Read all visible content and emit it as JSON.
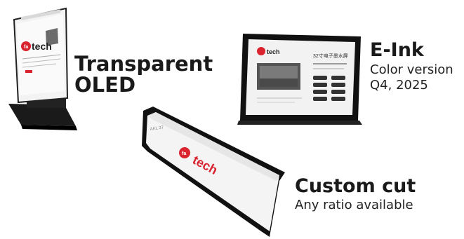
{
  "products": {
    "transparent_oled": {
      "title_line1": "Transparent",
      "title_line2": "OLED",
      "screen_brand": "faytech"
    },
    "eink": {
      "title": "E-Ink",
      "subtitle_line1": "Color version",
      "subtitle_line2": "Q4, 2025",
      "screen_brand": "faytech",
      "screen_heading": "32寸电子墨水屏"
    },
    "custom_cut": {
      "title": "Custom cut",
      "subtitle": "Any ratio available",
      "screen_brand": "faytech",
      "screen_corner_text": "AKL 37"
    }
  },
  "colors": {
    "brand_red": "#d9232e",
    "bezel": "#111111",
    "text": "#1a1a1a"
  }
}
